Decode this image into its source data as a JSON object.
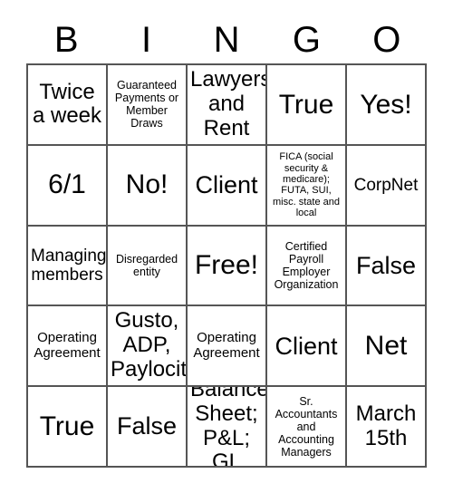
{
  "card": {
    "header_letters": [
      "B",
      "I",
      "N",
      "G",
      "O"
    ],
    "columns": [
      {
        "letter": "B",
        "cells": [
          {
            "text": "Twice a week",
            "size": "l"
          },
          {
            "text": "6/1",
            "size": "xxl"
          },
          {
            "text": "Managing members",
            "size": "m"
          },
          {
            "text": "Operating Agreement",
            "size": "s"
          },
          {
            "text": "True",
            "size": "xxl"
          }
        ]
      },
      {
        "letter": "I",
        "cells": [
          {
            "text": "Guaranteed Payments or Member Draws",
            "size": "xs"
          },
          {
            "text": "No!",
            "size": "xxl"
          },
          {
            "text": "Disregarded entity",
            "size": "xs"
          },
          {
            "text": "Gusto, ADP, Paylocity",
            "size": "l"
          },
          {
            "text": "False",
            "size": "xl"
          }
        ]
      },
      {
        "letter": "N",
        "cells": [
          {
            "text": "Lawyers and Rent",
            "size": "l"
          },
          {
            "text": "Client",
            "size": "xl"
          },
          {
            "text": "Free!",
            "size": "xxl"
          },
          {
            "text": "Operating Agreement",
            "size": "s"
          },
          {
            "text": "Balance Sheet; P&L; GL",
            "size": "l"
          }
        ]
      },
      {
        "letter": "G",
        "cells": [
          {
            "text": "True",
            "size": "xxl"
          },
          {
            "text": "FICA (social security & medicare); FUTA, SUI, misc. state and local",
            "size": "xxs"
          },
          {
            "text": "Certified Payroll Employer Organization",
            "size": "xs"
          },
          {
            "text": "Client",
            "size": "xl"
          },
          {
            "text": "Sr. Accountants and Accounting Managers",
            "size": "xs"
          }
        ]
      },
      {
        "letter": "O",
        "cells": [
          {
            "text": "Yes!",
            "size": "xxl"
          },
          {
            "text": "CorpNet",
            "size": "m"
          },
          {
            "text": "False",
            "size": "xl"
          },
          {
            "text": "Net",
            "size": "xxl"
          },
          {
            "text": "March 15th",
            "size": "l"
          }
        ]
      }
    ],
    "colors": {
      "background": "#ffffff",
      "text": "#000000",
      "grid_line": "#555555"
    }
  }
}
